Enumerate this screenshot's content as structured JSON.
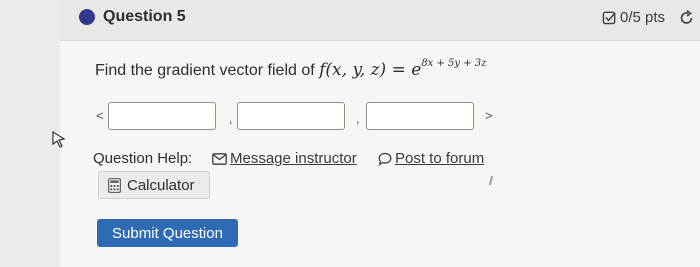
{
  "question": {
    "title": "Question 5",
    "points": "0/5 pts",
    "prompt_text": "Find the gradient vector field of ",
    "math_func": "f(x, y, z) = e",
    "math_exp": "8x + 5y + 3z"
  },
  "answer": {
    "open": "<",
    "close": ">",
    "sep1": ",",
    "sep2": ","
  },
  "help": {
    "label": "Question Help:",
    "message": "Message instructor",
    "forum": "Post to forum",
    "calculator": "Calculator"
  },
  "actions": {
    "submit": "Submit Question"
  },
  "colors": {
    "status_dot": "#34378c",
    "submit_bg": "#2f6bb5"
  },
  "icons": [
    "checkbox-icon",
    "redo-icon",
    "mail-icon",
    "comment-icon",
    "calculator-icon",
    "cursor-icon"
  ]
}
